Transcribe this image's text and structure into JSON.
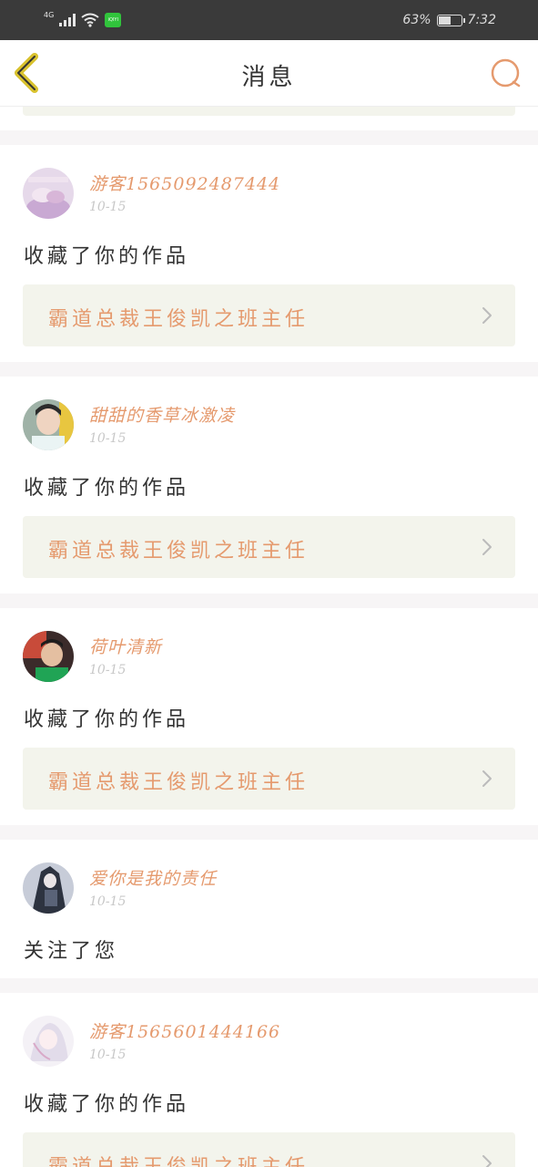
{
  "status_bar": {
    "network": "4G",
    "battery_percent": "63%",
    "battery_level": 0.63,
    "time": "7:32",
    "app_badge": "iQIYI"
  },
  "nav": {
    "title": "消息",
    "back_icon": "chevron-left-icon",
    "search_icon": "search-icon"
  },
  "colors": {
    "accent": "#e59a6e",
    "card_bg": "#f3f4ec",
    "divider": "#f7f5f6",
    "status_bar": "#3a3a3a",
    "back_icon": "#d9c22e"
  },
  "messages": [
    {
      "username": "游客1565092487444",
      "time": "10-15",
      "action": "收藏了你的作品",
      "work_title": "霸道总裁王俊凯之班主任"
    },
    {
      "username": "甜甜的香草冰激凌",
      "time": "10-15",
      "action": "收藏了你的作品",
      "work_title": "霸道总裁王俊凯之班主任"
    },
    {
      "username": "荷叶清新",
      "time": "10-15",
      "action": "收藏了你的作品",
      "work_title": "霸道总裁王俊凯之班主任"
    },
    {
      "username": "爱你是我的责任",
      "time": "10-15",
      "action": "关注了您"
    },
    {
      "username": "游客1565601444166",
      "time": "10-15",
      "action": "收藏了你的作品",
      "work_title": "霸道总裁王俊凯之班主任"
    }
  ]
}
